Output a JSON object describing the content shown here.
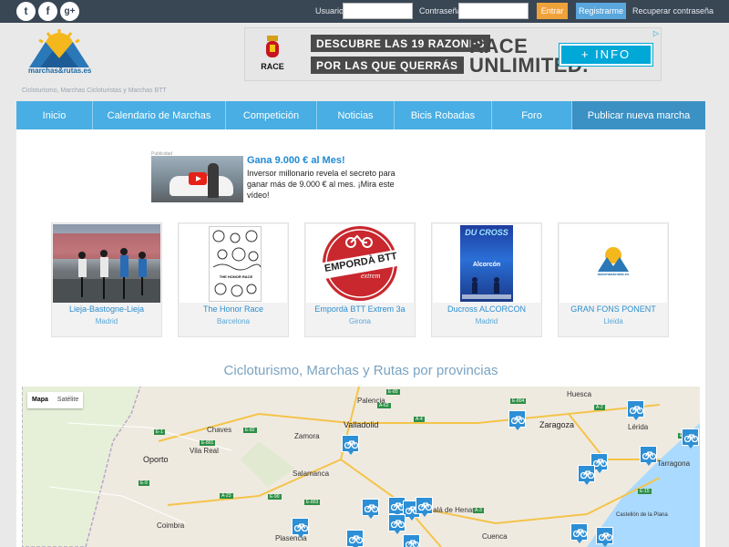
{
  "topbar": {
    "social": [
      {
        "name": "twitter-icon",
        "glyph": "t"
      },
      {
        "name": "facebook-icon",
        "glyph": "f"
      },
      {
        "name": "google-plus-icon",
        "glyph": "g+"
      }
    ],
    "usuario_label": "Usuario",
    "password_label": "Contraseña",
    "login_button": "Entrar",
    "register_button": "Registrarme",
    "recover_link": "Recuperar contraseña",
    "colors": {
      "bar": "#394654",
      "login": "#f0a23a",
      "register": "#5aa7dd"
    }
  },
  "header": {
    "logo_text": "marchas&rutas.es",
    "tagline": "Cicloturismo, Marchas Cicloturistas y Marchas BTT",
    "banner": {
      "brand": "RACE",
      "line1": "DESCUBRE LAS 19 RAZONES",
      "line2": "POR LAS QUE QUERRÁS",
      "headline1": "RACE",
      "headline2": "UNLIMITED.",
      "cta": "+ INFO"
    }
  },
  "nav": {
    "items": [
      "Inicio",
      "Calendario de Marchas",
      "Competición",
      "Noticias",
      "Bicis Robadas",
      "Foro",
      "Publicar nueva marcha"
    ]
  },
  "promo": {
    "label": "Publicidad",
    "title": "Gana 9.000 € al Mes!",
    "body": "Inversor millonario revela el secreto para ganar más de 9.000 € al mes. ¡Mira este vídeo!"
  },
  "events": [
    {
      "name": "Lieja-Bastogne-Lieja",
      "city": "Madrid"
    },
    {
      "name": "The Honor Race",
      "city": "Barcelona",
      "poster_text": "THE HONOR RACE"
    },
    {
      "name": "Empordà BTT Extrem 3a",
      "city": "Girona",
      "poster_text": "EMPORDÀ BTT",
      "poster_sub": "extrem"
    },
    {
      "name": "Ducross ALCORCON",
      "city": "Madrid",
      "poster_text": "DU CROSS",
      "poster_sub": "Alcorcón"
    },
    {
      "name": "GRAN FONS PONENT",
      "city": "Lleida",
      "poster_text": "marchas&rutas.es"
    }
  ],
  "section_title": "Cicloturismo, Marchas y Rutas por provincias",
  "map": {
    "type_buttons": [
      "Mapa",
      "Satélite"
    ],
    "cities": [
      "Huesca",
      "Palencia",
      "Valladolid",
      "Zaragoza",
      "Lérida",
      "Chaves",
      "Vila Real",
      "Zamora",
      "Tarragona",
      "Oporto",
      "Salamanca",
      "Alcalá de Henares",
      "Plasencia",
      "Coimbra",
      "Cuenca",
      "Castellón de la Plana"
    ],
    "roads": [
      "E-80",
      "A-62",
      "E-804",
      "A-2",
      "E-90",
      "A-23",
      "E-803",
      "E-1",
      "E-82",
      "E-801",
      "A-4",
      "A-3",
      "E-15",
      "E-9",
      "E-7"
    ]
  }
}
